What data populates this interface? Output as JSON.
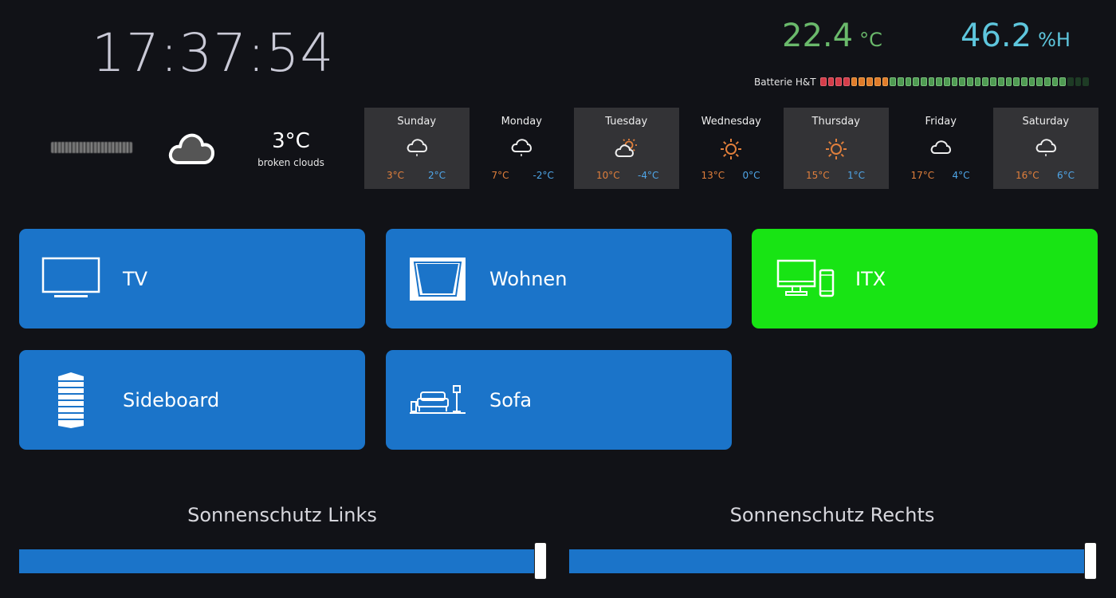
{
  "clock": {
    "time": "17:37:54"
  },
  "sensors": {
    "temperature": {
      "value": "22.4",
      "unit": "°C"
    },
    "humidity": {
      "value": "46.2",
      "unit": "%H"
    }
  },
  "battery": {
    "label": "Batterie H&T",
    "segments": [
      "red",
      "red",
      "red",
      "red",
      "orange",
      "orange",
      "orange",
      "orange",
      "orange",
      "green",
      "green",
      "green",
      "green",
      "green",
      "green",
      "green",
      "green",
      "green",
      "green",
      "green",
      "green",
      "green",
      "green",
      "green",
      "green",
      "green",
      "green",
      "green",
      "green",
      "green",
      "green",
      "green",
      "off",
      "off",
      "off"
    ]
  },
  "current_weather": {
    "temperature": "3°C",
    "description": "broken clouds",
    "icon": "cloud-icon"
  },
  "forecast": [
    {
      "day": "Sunday",
      "icon": "cloud-rain-icon",
      "high": "3°C",
      "low": "2°C",
      "shade": true
    },
    {
      "day": "Monday",
      "icon": "cloud-rain-icon",
      "high": "7°C",
      "low": "-2°C",
      "shade": false
    },
    {
      "day": "Tuesday",
      "icon": "sun-cloud-icon",
      "high": "10°C",
      "low": "-4°C",
      "shade": true
    },
    {
      "day": "Wednesday",
      "icon": "sun-icon",
      "high": "13°C",
      "low": "0°C",
      "shade": false
    },
    {
      "day": "Thursday",
      "icon": "sun-icon",
      "high": "15°C",
      "low": "1°C",
      "shade": true
    },
    {
      "day": "Friday",
      "icon": "cloud-icon",
      "high": "17°C",
      "low": "4°C",
      "shade": false
    },
    {
      "day": "Saturday",
      "icon": "cloud-rain-icon",
      "high": "16°C",
      "low": "6°C",
      "shade": true
    }
  ],
  "tiles": {
    "tv": {
      "label": "TV",
      "icon": "tv-icon"
    },
    "wohnen": {
      "label": "Wohnen",
      "icon": "frame-icon"
    },
    "itx": {
      "label": "ITX",
      "icon": "desktop-phone-icon",
      "color": "#18e414"
    },
    "sideboard": {
      "label": "Sideboard",
      "icon": "tower-icon"
    },
    "sofa": {
      "label": "Sofa",
      "icon": "sofa-lamp-icon"
    }
  },
  "sliders": {
    "left": {
      "label": "Sonnenschutz Links",
      "value_fraction": 1.0
    },
    "right": {
      "label": "Sonnenschutz Rechts",
      "value_fraction": 1.0
    }
  },
  "colors": {
    "tile_blue": "#1b74c9",
    "tile_green": "#18e414",
    "temperature": "#6ab96b",
    "humidity": "#5ec6dd",
    "forecast_high": "#e07f3c",
    "forecast_low": "#4fa6e8"
  }
}
